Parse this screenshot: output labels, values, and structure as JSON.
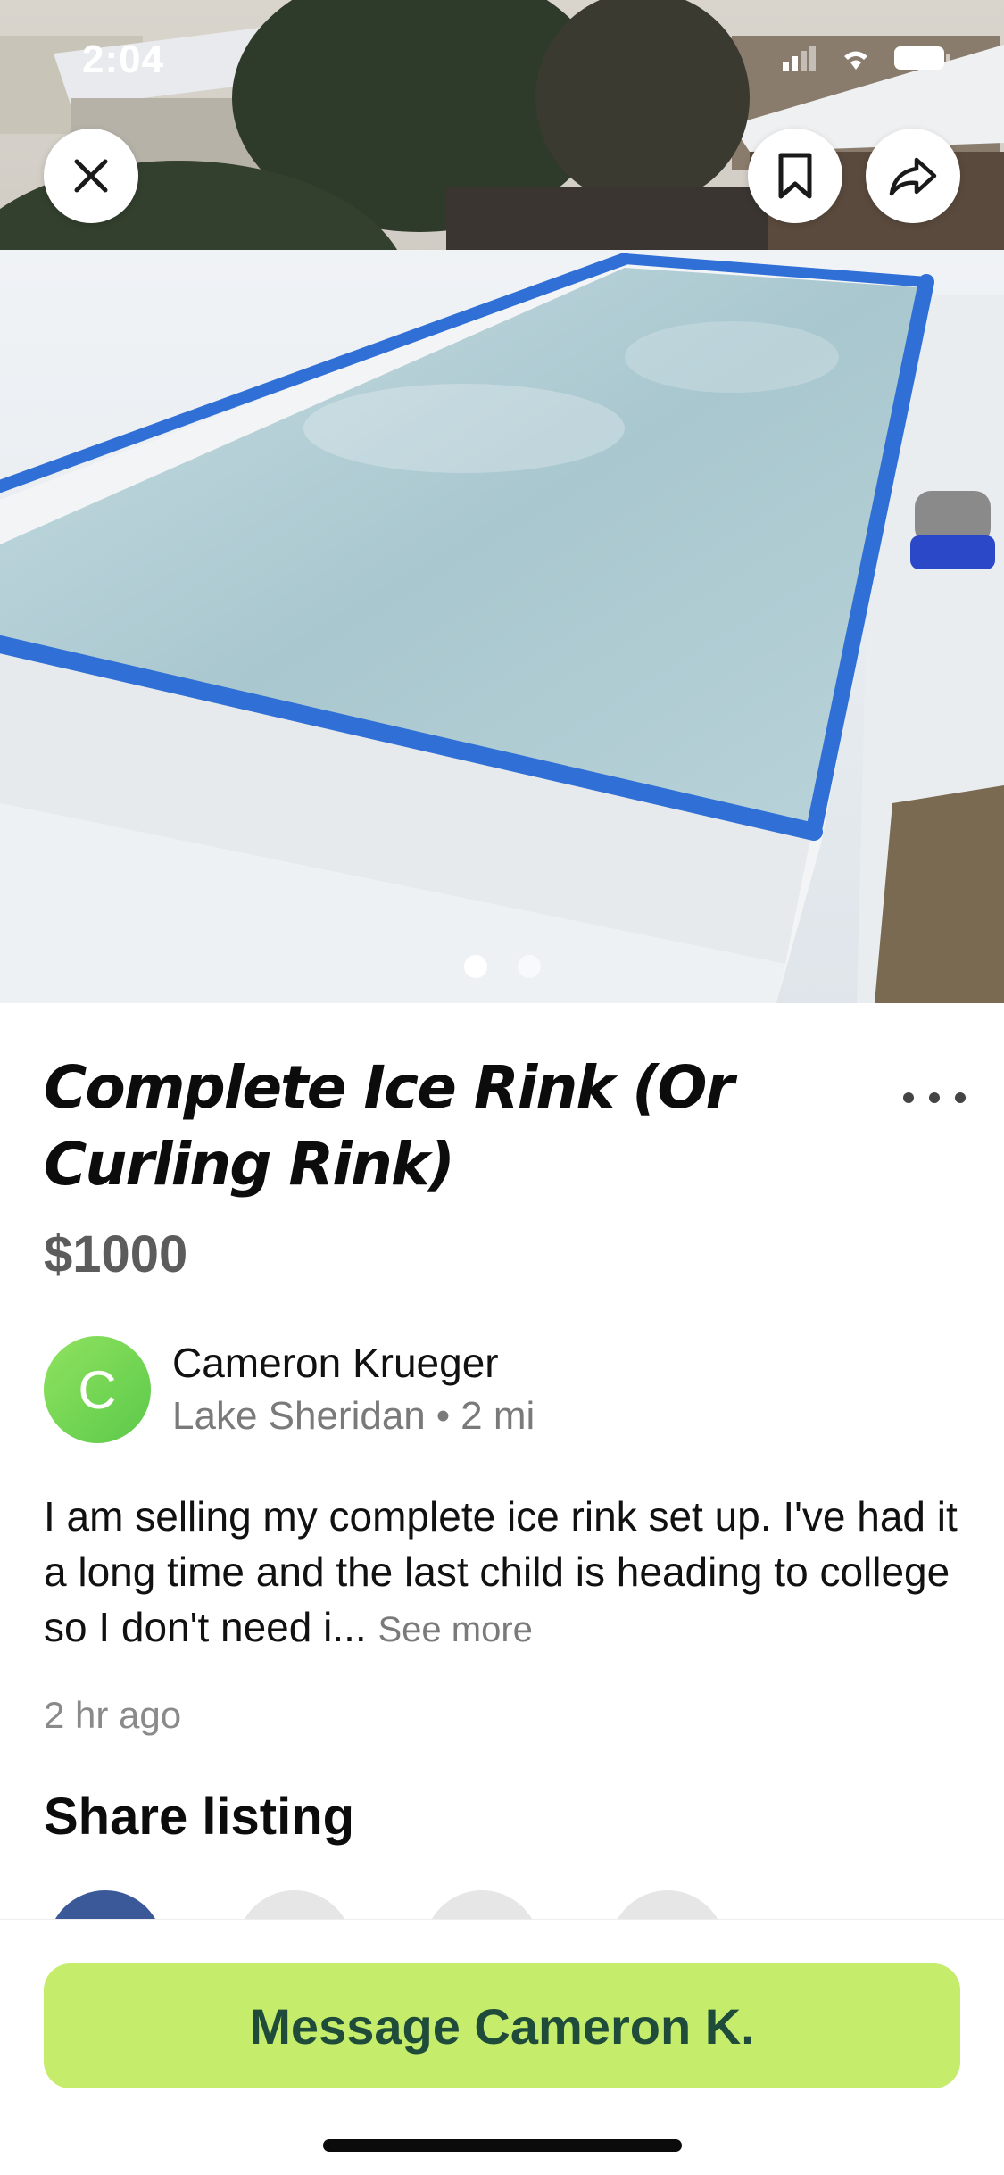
{
  "status_bar": {
    "time": "2:04"
  },
  "gallery": {
    "image_count": 2,
    "active_index": 0
  },
  "actions": {
    "close_icon": "close-icon",
    "bookmark_icon": "bookmark-icon",
    "share_icon": "share-arrow-icon"
  },
  "listing": {
    "title": "Complete Ice Rink (Or Curling Rink)",
    "price": "$1000",
    "description": "I am selling my complete ice rink set up.  I've had it a long time and the last child is heading to college so I don't need i...",
    "see_more": "See more",
    "posted": "2 hr ago"
  },
  "seller": {
    "initial": "C",
    "name": "Cameron Krueger",
    "location": "Lake Sheridan",
    "separator": "•",
    "distance": "2 mi"
  },
  "share": {
    "title": "Share listing"
  },
  "cta": {
    "label": "Message Cameron K."
  },
  "colors": {
    "cta_bg": "#c5ec6b",
    "cta_text": "#1f4b3b",
    "avatar": "#6fd152"
  }
}
